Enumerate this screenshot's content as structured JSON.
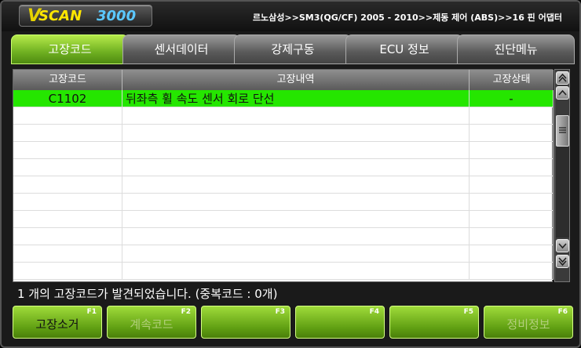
{
  "header": {
    "logo_v": "V",
    "logo_scan": "SCAN",
    "logo_num": "3000",
    "breadcrumb": "르노삼성>>SM3(QG/CF) 2005 - 2010>>제동 제어 (ABS)>>16 핀 어댑터"
  },
  "tabs": [
    {
      "label": "고장코드",
      "active": true
    },
    {
      "label": "센서데이터",
      "active": false
    },
    {
      "label": "강제구동",
      "active": false
    },
    {
      "label": "ECU 정보",
      "active": false
    },
    {
      "label": "진단메뉴",
      "active": false
    }
  ],
  "table": {
    "columns": [
      "고장코드",
      "고장내역",
      "고장상태"
    ],
    "rows": [
      {
        "code": "C1102",
        "description": "뒤좌측 휠 속도 센서 회로 단선",
        "state": "-",
        "selected": true
      }
    ],
    "empty_rows": 10
  },
  "scrollbar": {
    "top_icon": "scroll-top-icon",
    "up_icon": "scroll-up-icon",
    "down_icon": "scroll-down-icon",
    "bottom_icon": "scroll-bottom-icon"
  },
  "status": {
    "text": "1 개의 고장코드가 발견되었습니다. (중복코드 :  0개)"
  },
  "function_keys": [
    {
      "key": "F1",
      "label": "고장소거",
      "enabled": true
    },
    {
      "key": "F2",
      "label": "계속코드",
      "enabled": false
    },
    {
      "key": "F3",
      "label": "",
      "enabled": false
    },
    {
      "key": "F4",
      "label": "",
      "enabled": false
    },
    {
      "key": "F5",
      "label": "",
      "enabled": false
    },
    {
      "key": "F6",
      "label": "정비정보",
      "enabled": false
    }
  ],
  "colors": {
    "accent_green": "#25e600",
    "tab_active": "#6fb021",
    "logo_yellow": "#ffe600",
    "logo_blue": "#5bc8ff"
  }
}
